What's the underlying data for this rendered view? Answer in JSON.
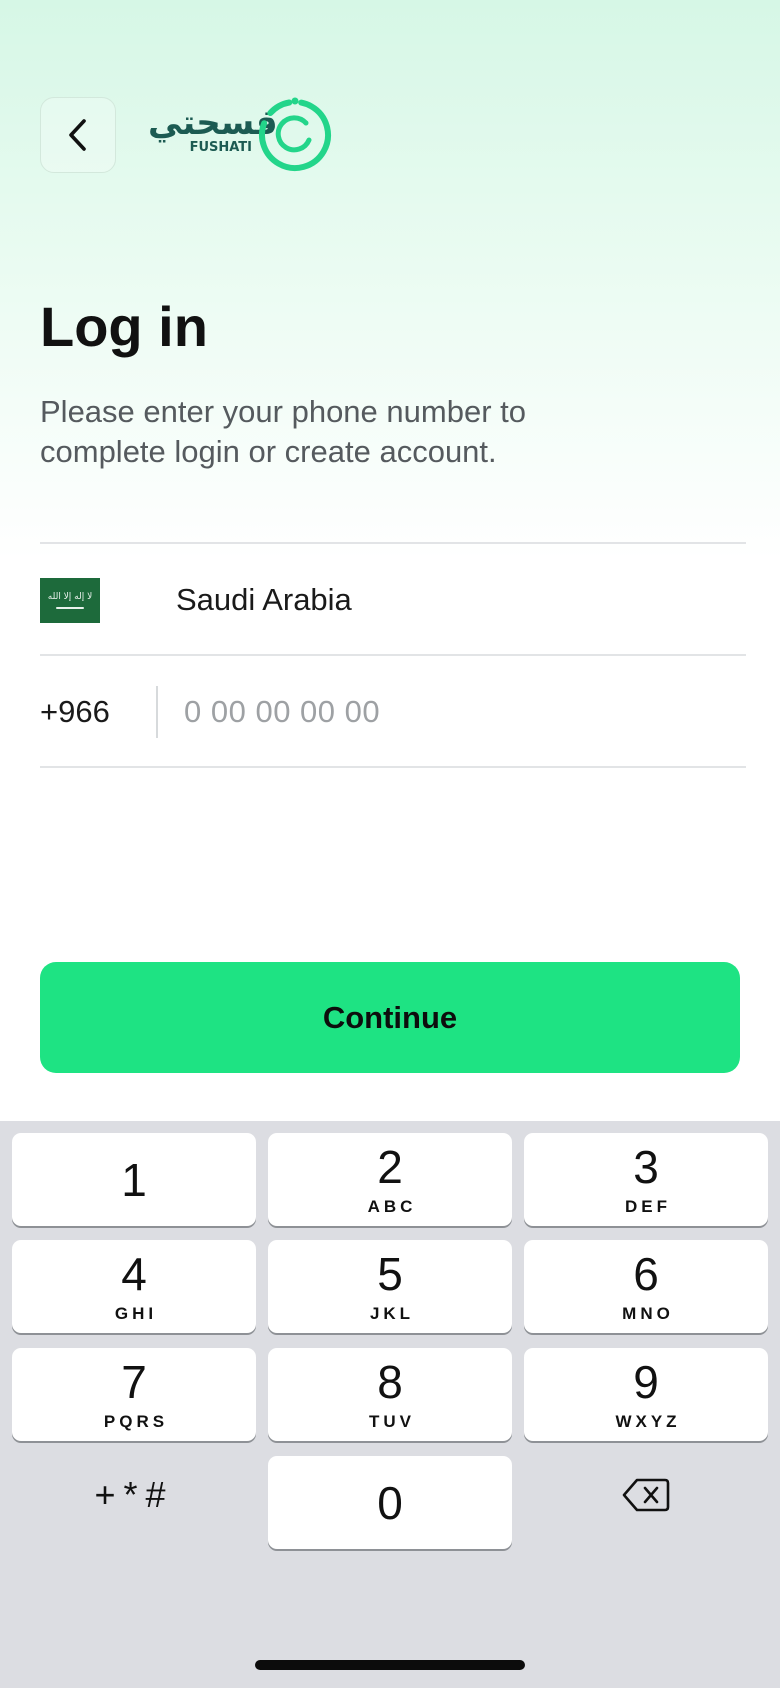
{
  "header": {
    "back_icon": "chevron-left-icon",
    "logo_arabic": "فسحتي",
    "logo_english": "FUSHATI",
    "logo_colors": {
      "text": "#1c5b52",
      "ring": "#23d58a"
    }
  },
  "login": {
    "title": "Log in",
    "subtitle": "Please enter your phone number to complete login or create account."
  },
  "country": {
    "name": "Saudi Arabia",
    "flag_icon": "saudi-arabia-flag-icon",
    "flag_color": "#1d6a3b"
  },
  "phone": {
    "dial_code": "+966",
    "placeholder": "0 00 00 00 00",
    "value": ""
  },
  "continue_label": "Continue",
  "colors": {
    "accent": "#1ee383"
  },
  "keypad": {
    "keys": [
      {
        "num": "1",
        "letters": ""
      },
      {
        "num": "2",
        "letters": "ABC"
      },
      {
        "num": "3",
        "letters": "DEF"
      },
      {
        "num": "4",
        "letters": "GHI"
      },
      {
        "num": "5",
        "letters": "JKL"
      },
      {
        "num": "6",
        "letters": "MNO"
      },
      {
        "num": "7",
        "letters": "PQRS"
      },
      {
        "num": "8",
        "letters": "TUV"
      },
      {
        "num": "9",
        "letters": "WXYZ"
      },
      {
        "num": "0",
        "letters": ""
      }
    ],
    "symbols_label": "+*#",
    "delete_icon": "backspace-icon"
  }
}
